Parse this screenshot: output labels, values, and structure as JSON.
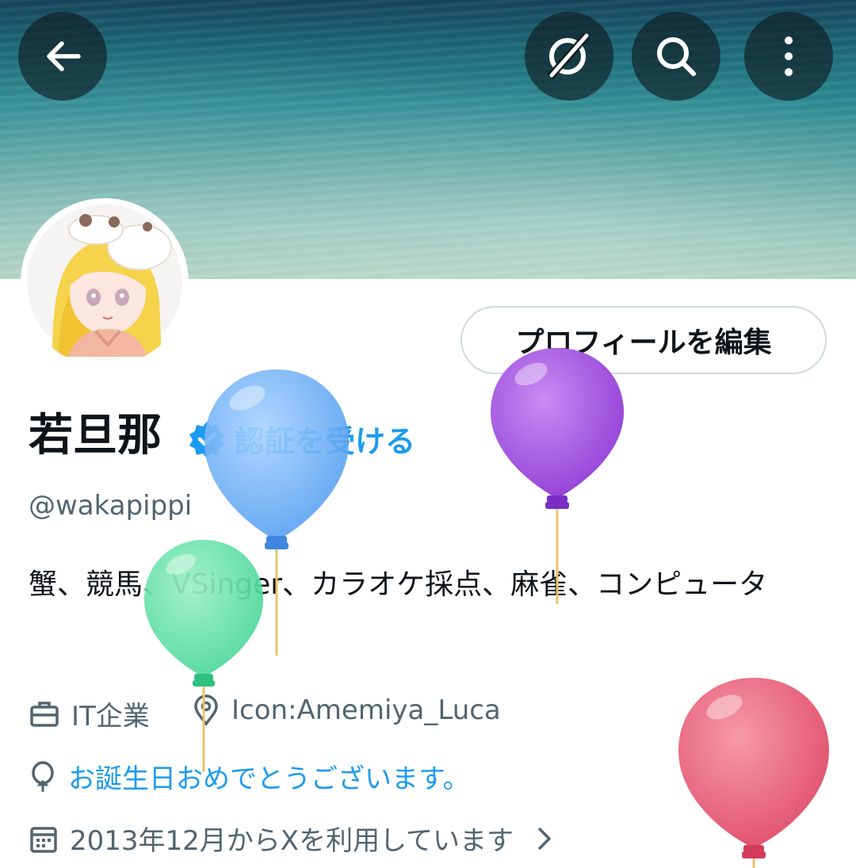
{
  "header": {
    "back_icon": "arrow-left-icon",
    "grok_icon": "grok-icon",
    "search_icon": "search-icon",
    "more_icon": "more-vertical-icon"
  },
  "profile": {
    "edit_label": "プロフィールを編集",
    "name": "若旦那",
    "verify_label": "認証を受ける",
    "handle": "@wakapippi",
    "bio": "蟹、競馬、VSinger、カラオケ採点、麻雀、コンピュータ",
    "work": "IT企業",
    "location": "Icon:Amemiya_Luca",
    "birthday": "お誕生日おめでとうございます。",
    "joined": "2013年12月からXを利用しています"
  },
  "colors": {
    "accent": "#1d9bf0",
    "secondary_text": "#536471",
    "balloon_blue": "#6ab0f5",
    "balloon_purple": "#a24de0",
    "balloon_green": "#5fe0a6",
    "balloon_red": "#e85b78"
  }
}
